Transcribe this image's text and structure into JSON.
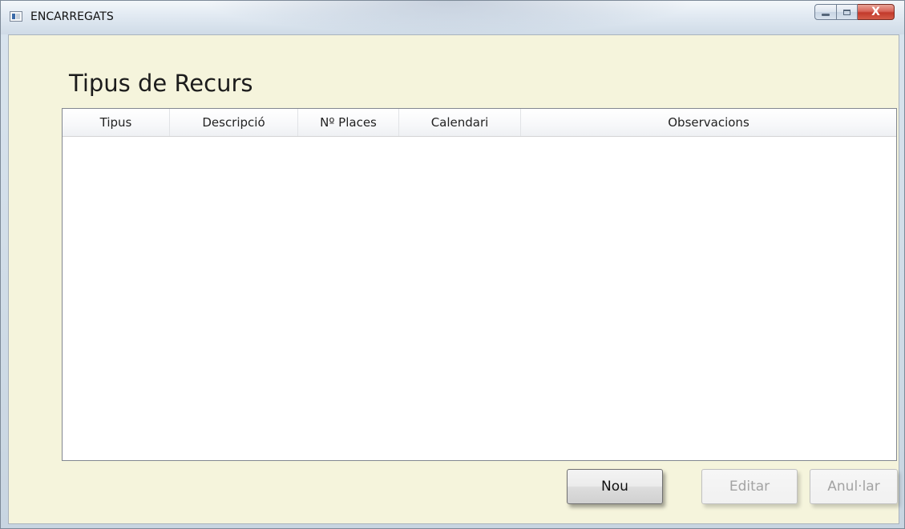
{
  "window": {
    "title": "ENCARREGATS",
    "controls": {
      "minimize": "minimize-icon",
      "maximize": "maximize-icon",
      "close": "X"
    }
  },
  "page": {
    "title": "Tipus de Recurs"
  },
  "grid": {
    "columns": [
      "Tipus",
      "Descripció",
      "Nº Places",
      "Calendari",
      "Observacions"
    ],
    "rows": []
  },
  "buttons": {
    "nou": "Nou",
    "editar": "Editar",
    "anullar": "Anul·lar"
  },
  "colors": {
    "client_background": "#f5f4dc",
    "grid_background": "#ffffff",
    "close_button": "#c23a2b"
  }
}
